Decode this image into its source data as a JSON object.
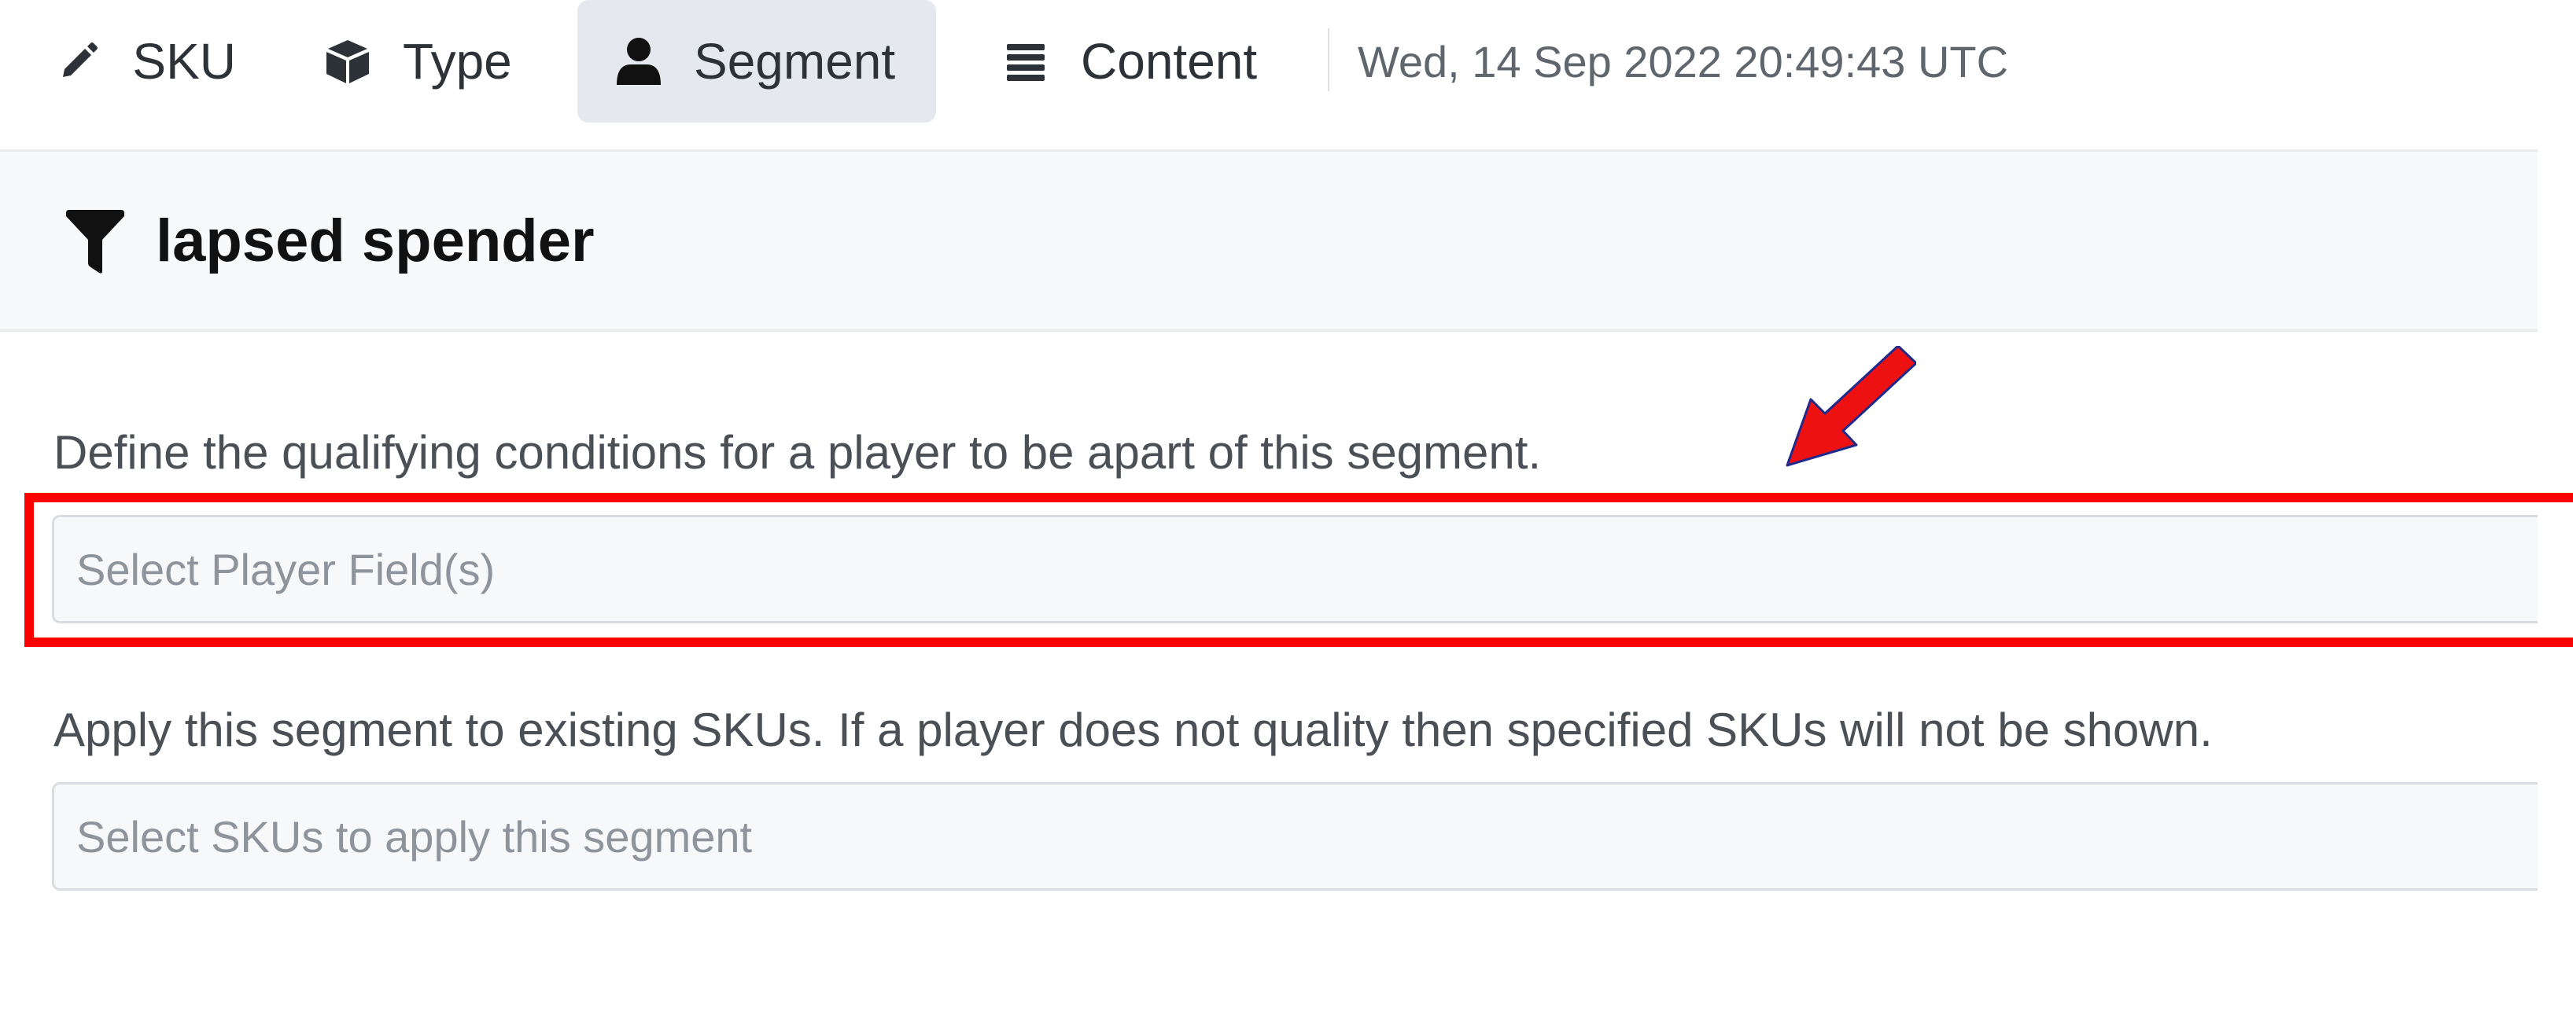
{
  "nav": {
    "tabs": [
      {
        "label": "SKU",
        "icon": "pencil-icon",
        "active": false
      },
      {
        "label": "Type",
        "icon": "cube-icon",
        "active": false
      },
      {
        "label": "Segment",
        "icon": "user-icon",
        "active": true
      },
      {
        "label": "Content",
        "icon": "list-icon",
        "active": false
      }
    ],
    "timestamp": "Wed, 14 Sep 2022 20:49:43 UTC"
  },
  "header": {
    "icon": "filter-icon",
    "title": "lapsed spender"
  },
  "conditions": {
    "label": "Define the qualifying conditions for a player to be apart of this segment.",
    "placeholder": "Select Player Field(s)"
  },
  "apply": {
    "label": "Apply this segment to existing SKUs. If a player does not quality then specified SKUs will not be shown.",
    "placeholder": "Select SKUs to apply this segment"
  },
  "annotation": {
    "highlight_color": "#ff0000",
    "arrow_fill": "#ee1111",
    "arrow_outline": "#1f2a8c"
  },
  "colors": {
    "active_tab_bg": "#e5e8ef",
    "header_bg": "#f8f9fb"
  }
}
